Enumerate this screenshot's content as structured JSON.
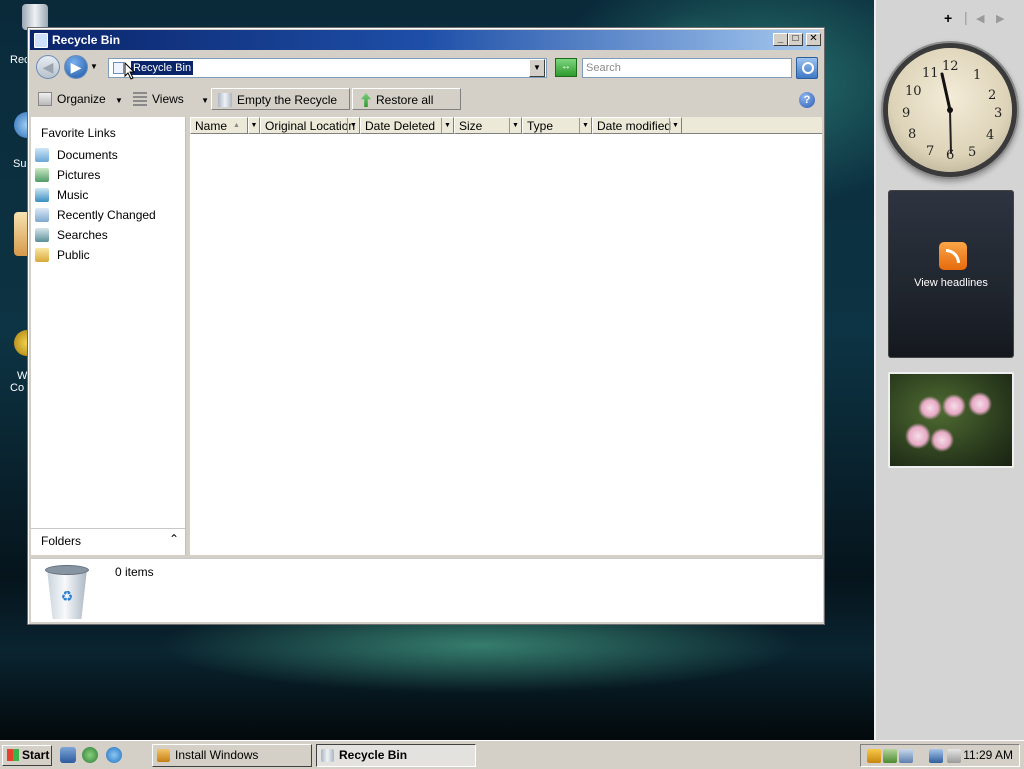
{
  "window": {
    "title": "Recycle Bin",
    "minimize": "_",
    "maximize": "□",
    "close": "✕"
  },
  "address": {
    "value": "Recycle Bin",
    "search_placeholder": "Search"
  },
  "toolbar": {
    "organize": "Organize",
    "views": "Views",
    "empty": "Empty the Recycle Bin",
    "restore": "Restore all items"
  },
  "favorites": {
    "header": "Favorite Links",
    "items": [
      {
        "label": "Documents",
        "icon": "documents-icon"
      },
      {
        "label": "Pictures",
        "icon": "pictures-icon"
      },
      {
        "label": "Music",
        "icon": "music-icon"
      },
      {
        "label": "Recently Changed",
        "icon": "recently-changed-icon"
      },
      {
        "label": "Searches",
        "icon": "searches-icon"
      },
      {
        "label": "Public",
        "icon": "public-folder-icon"
      }
    ]
  },
  "folders": {
    "label": "Folders"
  },
  "columns": [
    "Name",
    "Original Location",
    "Date Deleted",
    "Size",
    "Type",
    "Date modified"
  ],
  "details": {
    "count": "0 items"
  },
  "desktop_icons": [
    "Rec",
    "Su",
    "W",
    "Co"
  ],
  "sidebar": {
    "clock_numbers": [
      "12",
      "1",
      "2",
      "3",
      "4",
      "5",
      "6",
      "7",
      "8",
      "9",
      "10",
      "11"
    ],
    "feed_label": "View headlines"
  },
  "taskbar": {
    "start": "Start",
    "tasks": [
      {
        "label": "Install Windows",
        "active": false
      },
      {
        "label": "Recycle Bin",
        "active": true
      }
    ],
    "time": "11:29 AM"
  },
  "colors": {
    "title_start": "#0a246a",
    "title_end": "#a6caf0",
    "chrome": "#d4d0c8",
    "selection": "#0a246a"
  }
}
